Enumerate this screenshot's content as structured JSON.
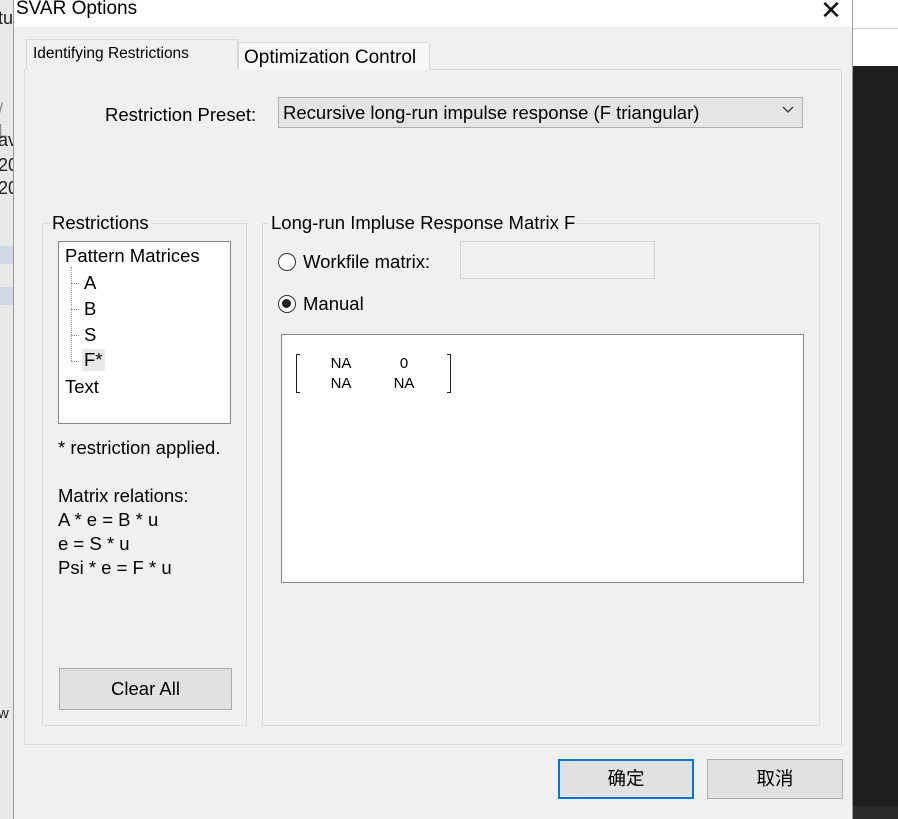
{
  "background": {
    "left_fragments": [
      "tu",
      "/ L",
      "av",
      "20",
      "20",
      "w"
    ]
  },
  "dialog": {
    "title": "SVAR Options",
    "close_glyph": "✕"
  },
  "tabs": [
    {
      "label": "Identifying Restrictions",
      "active": true
    },
    {
      "label": "Optimization Control",
      "active": false
    }
  ],
  "preset": {
    "label": "Restriction Preset:",
    "selected": "Recursive long-run impulse response (F triangular)"
  },
  "restrictions": {
    "legend": "Restrictions",
    "tree": {
      "root": "Pattern Matrices",
      "children": [
        "A",
        "B",
        "S",
        "F*"
      ],
      "selected": "F*",
      "extra": "Text"
    },
    "note": "* restriction applied.",
    "relations_title": "Matrix relations:",
    "relations": [
      "A * e = B * u",
      "e = S * u",
      "Psi * e = F * u"
    ],
    "clear_button": "Clear All"
  },
  "matrix_group": {
    "legend": "Long-run Impluse Response Matrix F",
    "workfile_label": "Workfile matrix:",
    "workfile_value": "",
    "manual_label": "Manual",
    "selected_option": "Manual",
    "matrix": [
      [
        "NA",
        "0"
      ],
      [
        "NA",
        "NA"
      ]
    ]
  },
  "footer": {
    "ok": "确定",
    "cancel": "取消"
  }
}
